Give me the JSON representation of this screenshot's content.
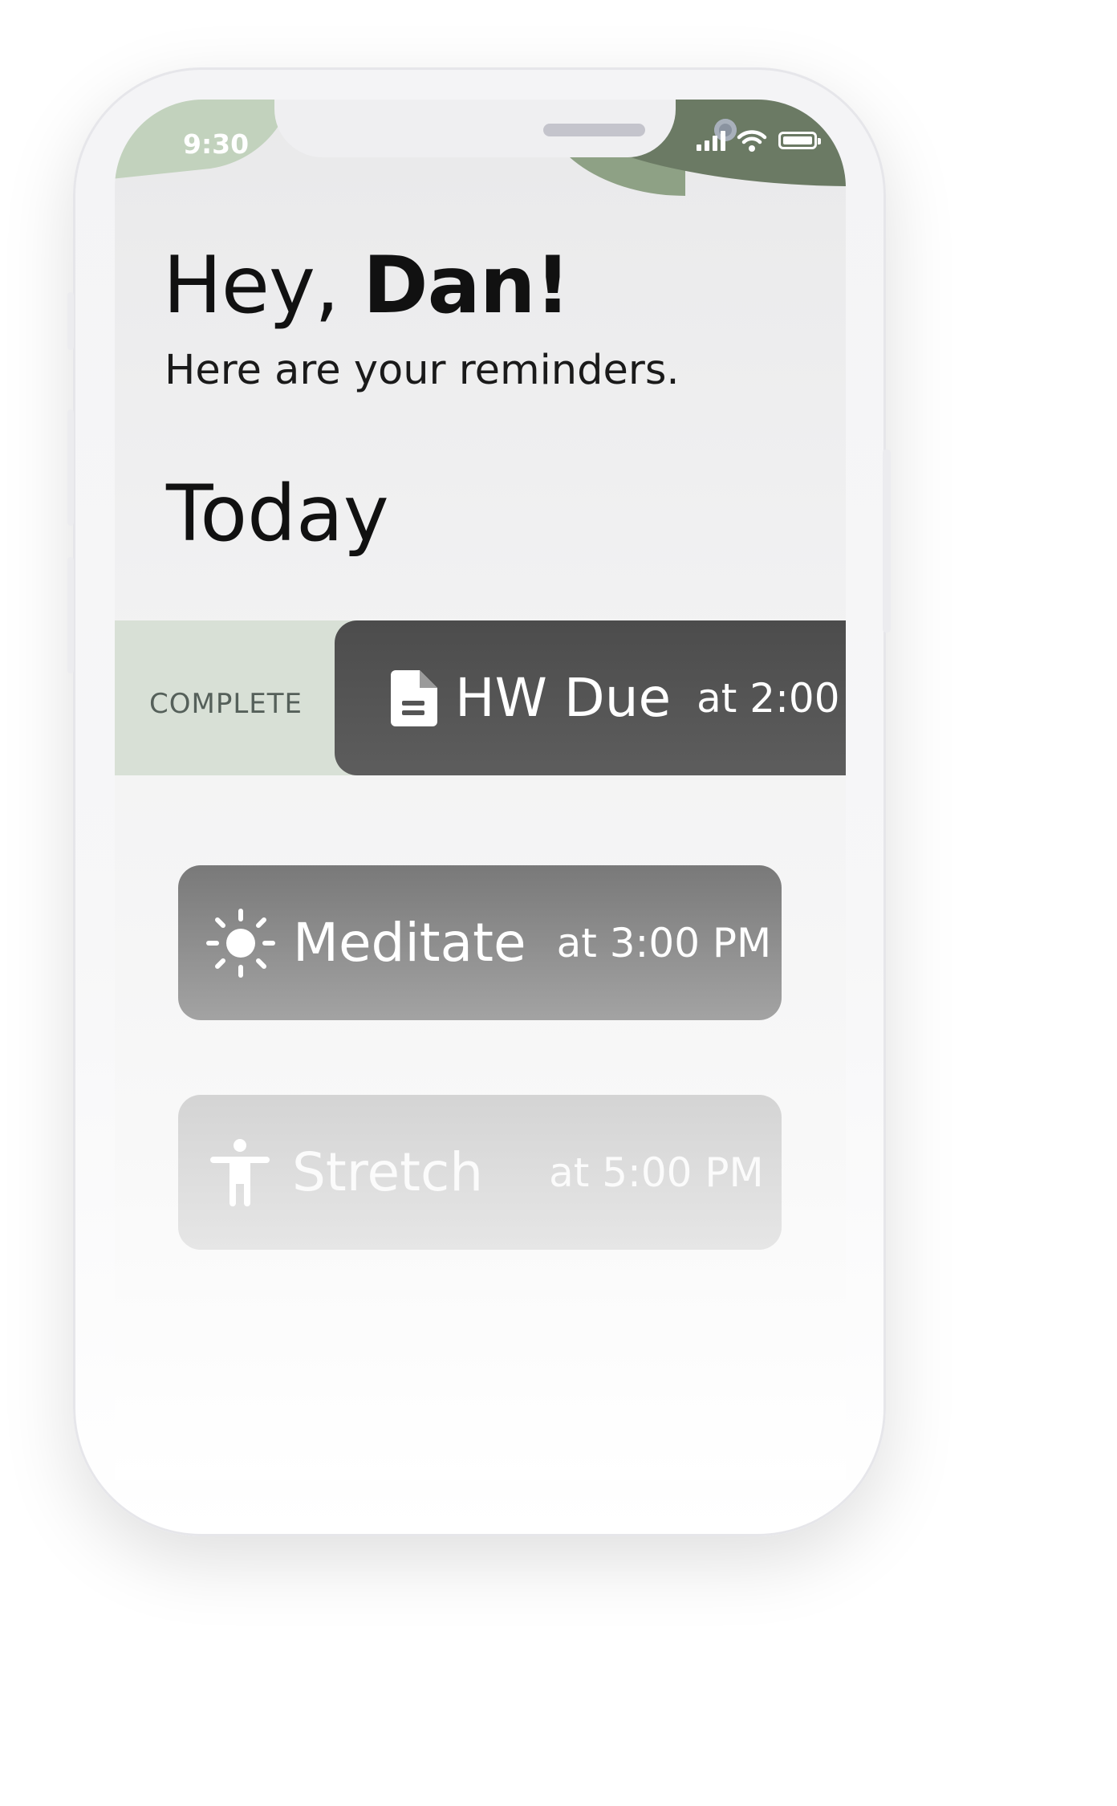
{
  "status_bar": {
    "time": "9:30",
    "icons": [
      "signal-icon",
      "wifi-icon",
      "battery-icon"
    ]
  },
  "header": {
    "greeting_prefix": "Hey, ",
    "greeting_name": "Dan!",
    "subtitle": "Here are your reminders."
  },
  "section": {
    "title": "Today"
  },
  "swipe_action": {
    "label": "COMPLETE",
    "color": "#d8e0d6"
  },
  "reminders": [
    {
      "icon": "document-icon",
      "title": "HW Due",
      "time": "at 2:00"
    },
    {
      "icon": "sun-icon",
      "title": "Meditate",
      "time": "at 3:00 PM"
    },
    {
      "icon": "stretch-person-icon",
      "title": "Stretch",
      "time": "at 5:00 PM"
    }
  ],
  "colors": {
    "accent_light": "#c2d2bd",
    "accent_dark": "#6b7a64",
    "card_dark": "#4c4c4c"
  }
}
